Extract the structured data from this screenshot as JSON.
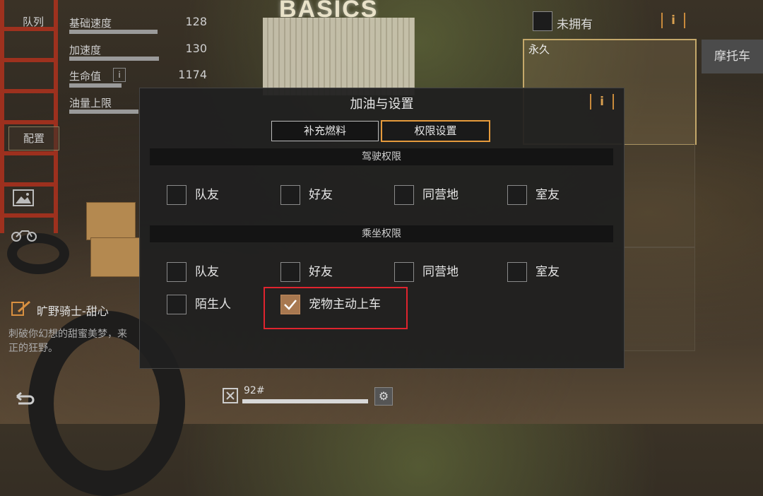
{
  "backdrop": {
    "sign_text": "BASICS"
  },
  "stats": [
    {
      "label": "基础速度",
      "value": "128"
    },
    {
      "label": "加速度",
      "value": "130"
    },
    {
      "label": "生命值",
      "value": "1174"
    },
    {
      "label": "油量上限",
      "value": ""
    }
  ],
  "left_panel": {
    "queue_label": "队列",
    "config_button": "配置",
    "vehicle_name": "旷野骑士-甜心",
    "vehicle_desc_line1": "刺破你幻想的甜蜜美梦，来",
    "vehicle_desc_line2": "正的狂野。"
  },
  "right_panel": {
    "not_owned_label": "未拥有",
    "card_badge": "永久",
    "motorcycle_tab": "摩托车"
  },
  "dialog": {
    "title": "加油与设置",
    "tabs": [
      {
        "label": "补充燃料",
        "active": false
      },
      {
        "label": "权限设置",
        "active": true
      }
    ],
    "drive_section": {
      "title": "驾驶权限",
      "options": [
        {
          "label": "队友",
          "checked": false
        },
        {
          "label": "好友",
          "checked": false
        },
        {
          "label": "同营地",
          "checked": false
        },
        {
          "label": "室友",
          "checked": false
        }
      ]
    },
    "ride_section": {
      "title": "乘坐权限",
      "options": [
        {
          "label": "队友",
          "checked": false
        },
        {
          "label": "好友",
          "checked": false
        },
        {
          "label": "同营地",
          "checked": false
        },
        {
          "label": "室友",
          "checked": false
        },
        {
          "label": "陌生人",
          "checked": false
        },
        {
          "label": "宠物主动上车",
          "checked": true
        }
      ]
    }
  },
  "bottom": {
    "fuel_label": "92#"
  },
  "colors": {
    "accent": "#e59a3c",
    "highlight": "#e0242e",
    "checked": "#a87850"
  }
}
